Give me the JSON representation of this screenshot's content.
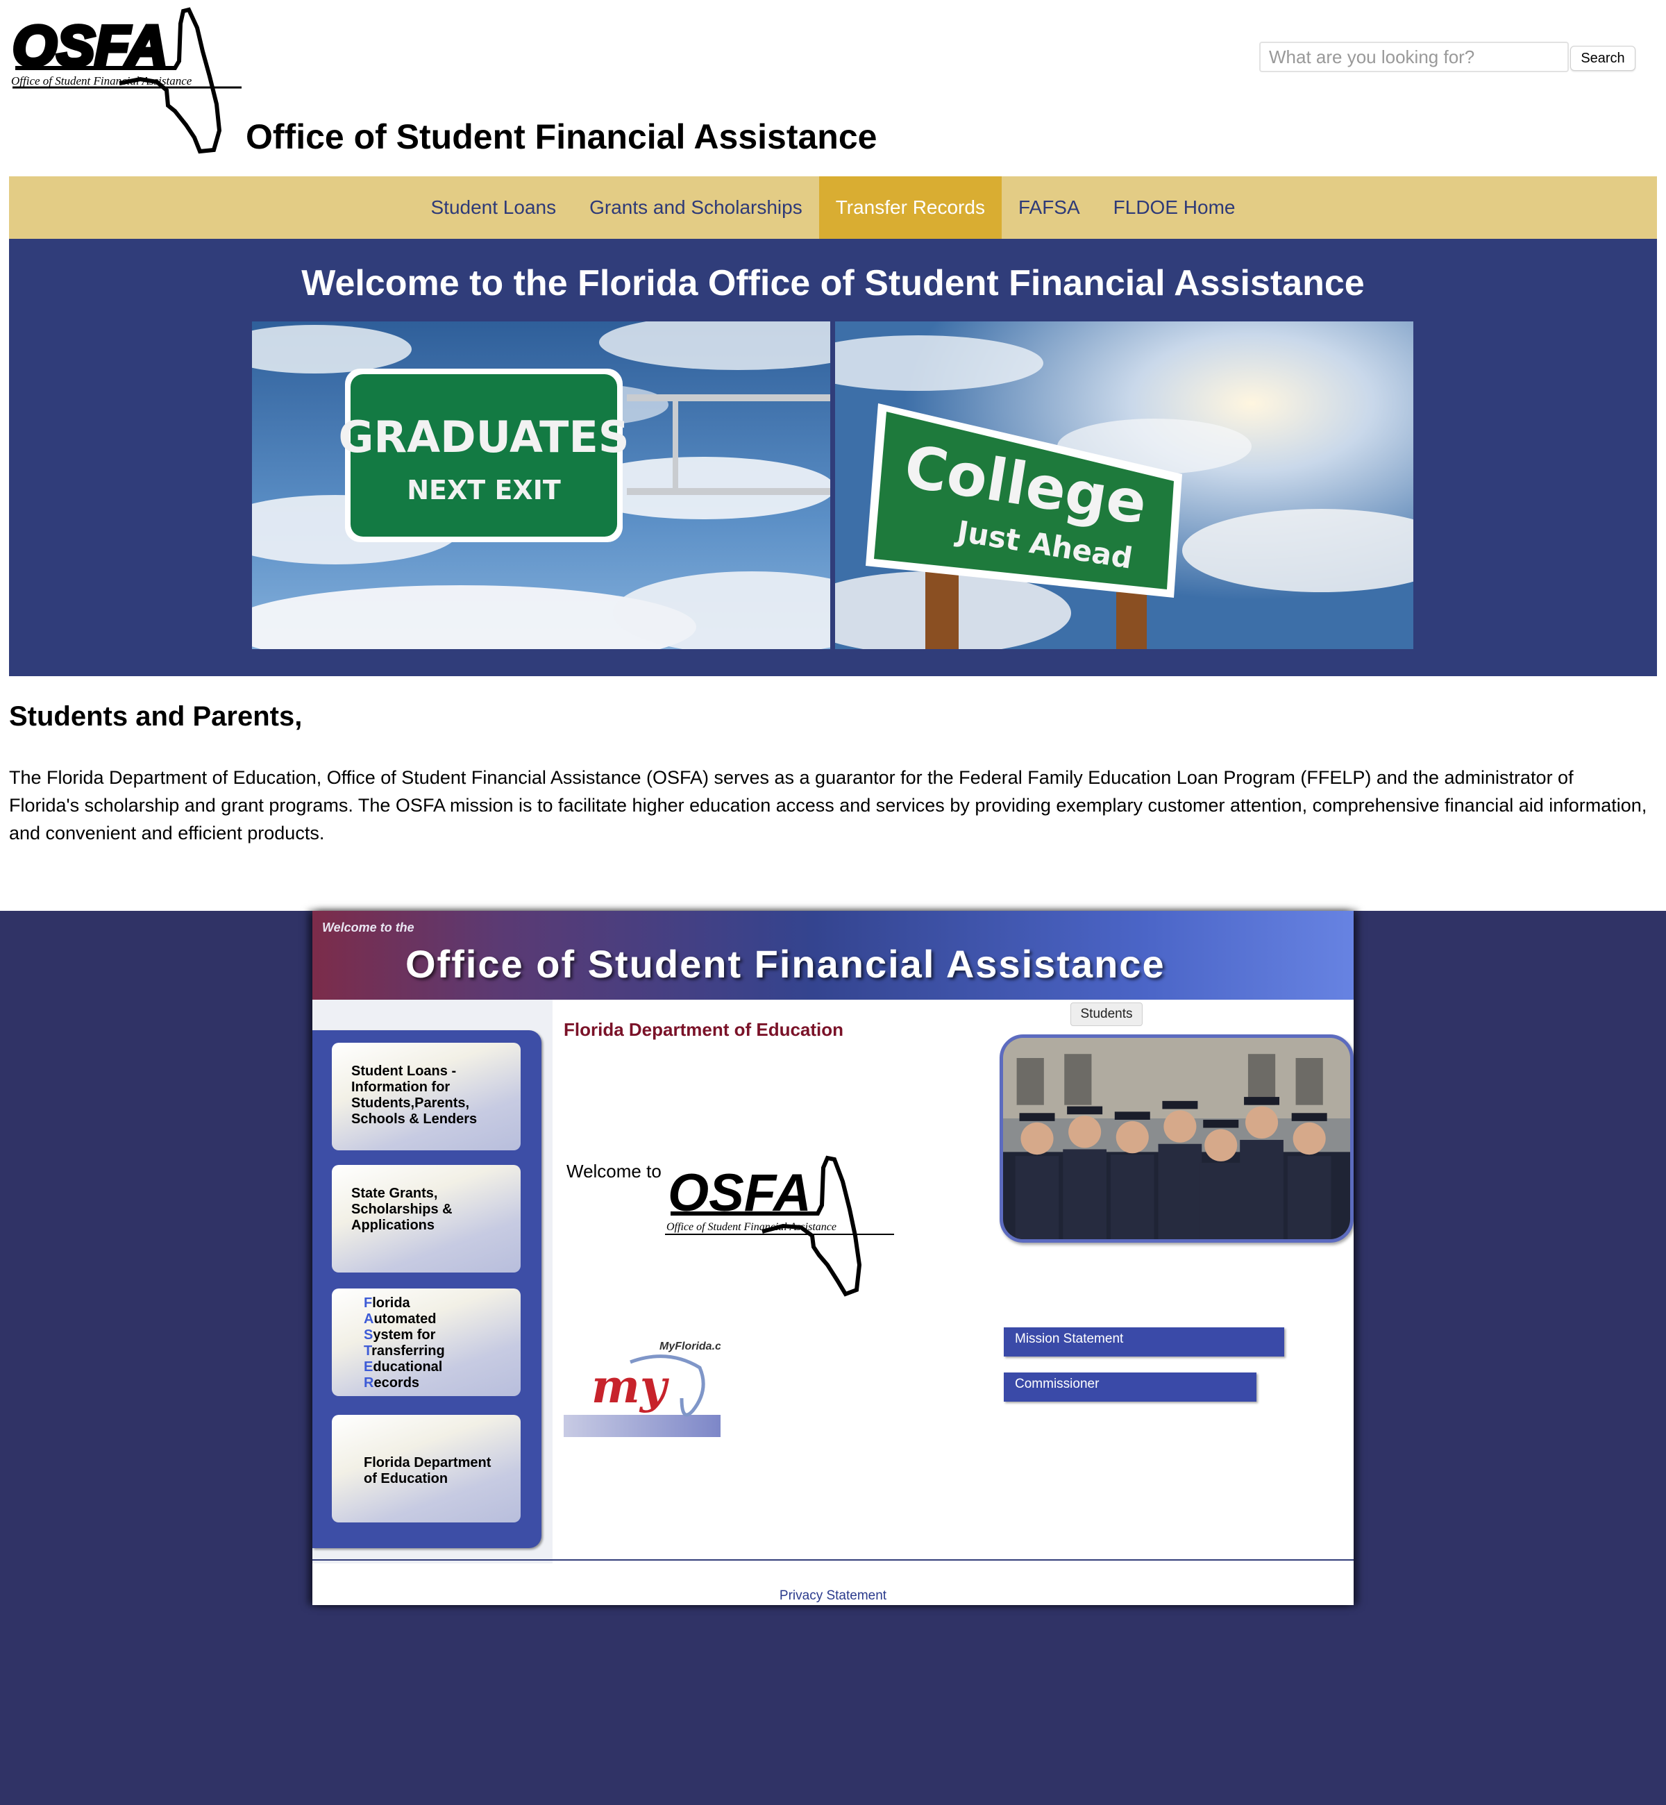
{
  "header": {
    "logo_text": "OSFA",
    "logo_subtitle": "Office of Student Financial Assistance",
    "title": "Office of Student Financial Assistance",
    "search_placeholder": "What are you looking for?",
    "search_button": "Search"
  },
  "nav": {
    "items": [
      {
        "label": "Student Loans",
        "active": false
      },
      {
        "label": "Grants and Scholarships",
        "active": false
      },
      {
        "label": "Transfer Records",
        "active": true
      },
      {
        "label": "FAFSA",
        "active": false
      },
      {
        "label": "FLDOE Home",
        "active": false
      }
    ]
  },
  "hero": {
    "title": "Welcome to the Florida Office of Student Financial Assistance",
    "left_sign": {
      "line1": "GRADUATES",
      "line2": "NEXT EXIT"
    },
    "right_sign": {
      "line1": "College",
      "line2": "Just Ahead"
    }
  },
  "intro": {
    "heading": "Students and Parents,",
    "text": "The Florida Department of Education, Office of Student Financial Assistance (OSFA) serves as a guarantor for the Federal Family Education Loan Program (FFELP) and the administrator of Florida's scholarship and grant programs. The OSFA mission is to facilitate higher education access and services by providing exemplary customer attention, comprehensive financial aid information, and convenient and efficient products."
  },
  "legacy": {
    "banner_small": "Welcome to the",
    "banner_title": "Office of Student Financial Assistance",
    "sidebar": {
      "btn1": "Student Loans - Information for Students,Parents, Schools & Lenders",
      "btn2": "State Grants, Scholarships & Applications",
      "btn3_caps": [
        "F",
        "A",
        "S",
        "T",
        "E",
        "R"
      ],
      "btn3_rest": [
        "lorida",
        "utomated",
        "ystem for",
        "ransferring",
        "ducational",
        "ecords"
      ],
      "btn4": "Florida Department of Education"
    },
    "dept_heading": "Florida Department of Education",
    "welcome_to": "Welcome to",
    "osfa_logo_text": "OSFA",
    "osfa_logo_subtitle": "Office of Student Financial Assistance",
    "myflorida_small": "MyFlorida.c",
    "myflorida_script": "my",
    "students_tab": "Students",
    "mission_link": "Mission Statement",
    "commissioner_link": "Commissioner",
    "privacy_link": "Privacy Statement"
  },
  "colors": {
    "nav_bg": "#e3cc85",
    "nav_active": "#d9ad32",
    "nav_text": "#2e3a78",
    "hero_bg": "#303d7a",
    "legacy_bg": "#303366",
    "dept_heading": "#7a1228"
  }
}
